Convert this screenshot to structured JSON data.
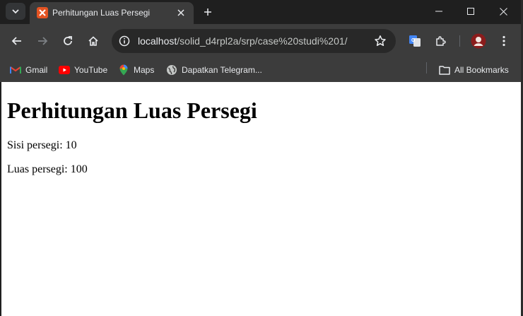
{
  "browser": {
    "tab": {
      "title": "Perhitungan Luas Persegi",
      "favicon": "xampp-icon"
    },
    "url": {
      "host": "localhost",
      "path": "/solid_d4rpl2a/srp/case%20studi%201/"
    },
    "bookmarks": [
      {
        "label": "Gmail",
        "icon": "gmail-icon"
      },
      {
        "label": "YouTube",
        "icon": "youtube-icon"
      },
      {
        "label": "Maps",
        "icon": "maps-icon"
      },
      {
        "label": "Dapatkan Telegram...",
        "icon": "globe-icon"
      }
    ],
    "all_bookmarks_label": "All Bookmarks",
    "colors": {
      "frame": "#1f1f1f",
      "toolbar": "#3c3c3c",
      "omnibox": "#282828",
      "accent_favicon": "#e35322"
    }
  },
  "page": {
    "heading": "Perhitungan Luas Persegi",
    "side_line": "Sisi persegi: 10",
    "area_line": "Luas persegi: 100"
  }
}
